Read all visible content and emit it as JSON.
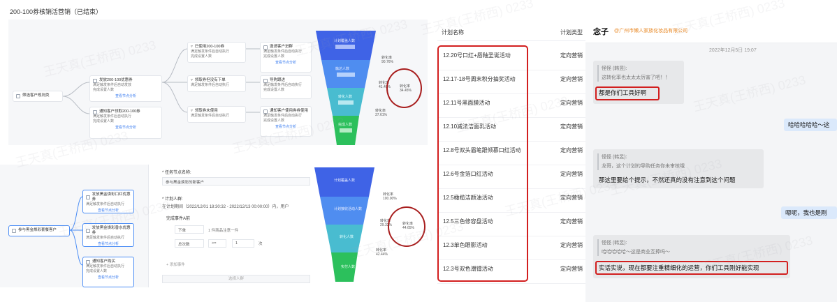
{
  "page_title": "200-100券核销活营销（已结束）",
  "top_canvas": {
    "start_node": "筛选客户规则类",
    "branch1": {
      "title": "发放200-100优惠券",
      "lines": [
        "满足触发条件后自动发放",
        "完成设置人数"
      ],
      "link": "查看节点分析"
    },
    "branch2": {
      "title": "通知客户领取200-100券",
      "lines": [
        "满足触发条件后自动执行",
        "完成设置人数"
      ],
      "link": "查看节点分析"
    },
    "cond1": {
      "title": "已使用200-100券",
      "lines": [
        "满足触发条件后自动执行",
        "完成设置人数"
      ]
    },
    "cond2": {
      "title": "领取券但没有下单",
      "lines": [
        "满足触发条件后自动执行"
      ]
    },
    "cond3": {
      "title": "领取券未使用",
      "lines": [
        "满足触发条件后自动执行"
      ]
    },
    "act1": {
      "title": "邀请客户进群",
      "lines": [
        "满足触发条件后自动执行",
        "完成设置人数"
      ],
      "link": "查看节点分析"
    },
    "act2": {
      "title": "导购跟进",
      "lines": [
        "满足触发条件后自动执行",
        "完成设置人数"
      ]
    },
    "act3": {
      "title": "通知客户使用券券使用",
      "lines": [
        "满足触发条件后自动执行",
        "完成设置人数"
      ],
      "link": "查看节点分析"
    },
    "funnel": {
      "labels": [
        "计划覆盖人数",
        "触达人数",
        "转化人数",
        "完成人数"
      ],
      "rates": [
        {
          "name": "转化率",
          "value": "90.76%"
        },
        {
          "name": "转化率",
          "value": "41.40%"
        },
        {
          "name": "转化率",
          "value": "37.61%"
        }
      ],
      "circled": {
        "name": "转化率",
        "value": "34.45%"
      }
    }
  },
  "bottom_canvas": {
    "start_node": "参与黑金焕彩套餐客户",
    "nodes": [
      {
        "title": "发放黑金焕彩口红优惠券",
        "lines": [
          "满足触发条件后自动执行"
        ],
        "link": "查看节点分析"
      },
      {
        "title": "发放黑金焕彩香水优惠券",
        "lines": [
          "满足触发条件后自动执行"
        ],
        "link": "查看节点分析"
      },
      {
        "title": "通知客户购买",
        "lines": [
          "满足触发条件后自动执行",
          "完成设置人数"
        ],
        "link": "查看节点分析"
      }
    ],
    "funnel": {
      "labels": [
        "计划覆盖人数",
        "计划接收活动人数",
        "转化人数",
        "实付人数"
      ],
      "rates": [
        {
          "name": "转化率",
          "value": "100.00%"
        },
        {
          "name": "转化率",
          "value": "29.32%"
        },
        {
          "name": "转化率",
          "value": "42.44%"
        }
      ],
      "circled": {
        "name": "转化率",
        "value": "44.65%"
      }
    }
  },
  "form": {
    "node_name_label": "* 任务节点名称:",
    "node_name_value": "参与黑金焕彩的新客户",
    "plan_people_label": "* 计划人群:",
    "plan_people_desc": "在计划期间（2022/12/01 18:30:32 - 2022/12/13 00:00:00）内，用户",
    "event_label": "完成事件A前",
    "event_select": "下单",
    "event_filter": "1 件商品注意一件",
    "metric_select": "总次数",
    "operator_select": ">=",
    "count_value": "1",
    "count_unit": "次",
    "add_event": "+ 添加事件",
    "submit": "选择人群"
  },
  "table": {
    "headers": [
      "计划名称",
      "计划类型"
    ],
    "rows": [
      {
        "name": "12.20号口红+唇釉圣诞活动",
        "type": "定向营销"
      },
      {
        "name": "12.17-18号周末积分抽奖活动",
        "type": "定向营销"
      },
      {
        "name": "12.11号黑面膜活动",
        "type": "定向营销"
      },
      {
        "name": "12.10减法洁面乳活动",
        "type": "定向营销"
      },
      {
        "name": "12.8号双头眉笔跟倾慕口红活动",
        "type": "定向营销"
      },
      {
        "name": "12.6号金箔口红活动",
        "type": "定向营销"
      },
      {
        "name": "12.5橄榄洁颜油活动",
        "type": "定向营销"
      },
      {
        "name": "12.5三色修容盘活动",
        "type": "定向营销"
      },
      {
        "name": "12.3单色眼影活动",
        "type": "定向营销"
      },
      {
        "name": "12.3号双色潮镭活动",
        "type": "定向营销"
      }
    ]
  },
  "chat": {
    "contact_name": "念子",
    "contact_org": "@广州市懒人家族化妆品有限公司",
    "date": "2022年12月5日 19:07",
    "messages": [
      {
        "quote_name": "怪怪 (韩昱):",
        "quote_text": "这转化率也太太太厉害了吧！！",
        "reply": "都是你们工具好啊"
      },
      {
        "mine": "哈哈哈哈哈～这"
      },
      {
        "quote_name": "怪怪 (韩昱):",
        "quote_text": "龙哥，这个计划的导购任务你未审核哦",
        "reply": "那这里要给个提示，不然还真的没有注意到这个问题"
      },
      {
        "mine": "嗯呢，我也是刚"
      },
      {
        "quote_name": "怪怪 (韩昱):",
        "quote_text": "哈哈哈哈哈～这是商业互捧吗～",
        "reply": "实话实说，现在都要注重精细化的运营，你们工具刚好能实现"
      }
    ]
  },
  "watermark": "王天真(王桥西) 0233",
  "colors": {
    "accent": "#3b7df0",
    "highlight_red": "#d21f1f",
    "circle_red": "#a81e1e",
    "org_orange": "#e98b2a",
    "my_bubble": "#dbe9fb"
  }
}
